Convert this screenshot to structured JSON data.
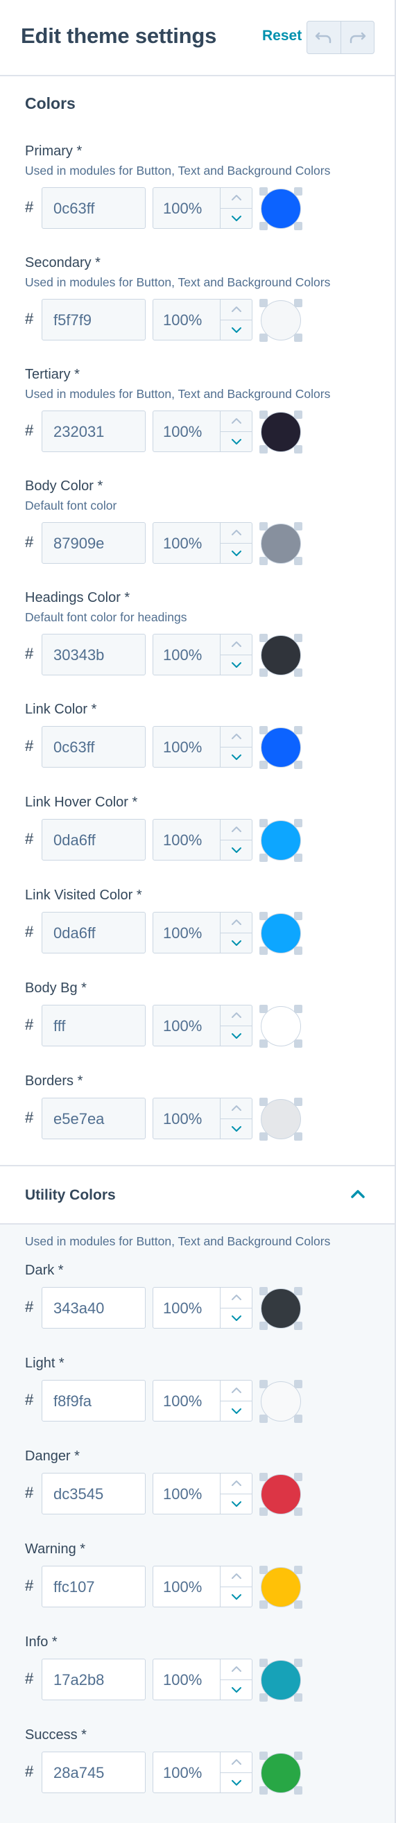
{
  "header": {
    "title": "Edit theme settings",
    "reset_label": "Reset"
  },
  "colors_section": {
    "title": "Colors",
    "fields": [
      {
        "label": "Primary *",
        "help": "Used in modules for Button, Text and Background Colors",
        "hex": "0c63ff",
        "opacity": "100%",
        "swatch": "#0c63ff"
      },
      {
        "label": "Secondary *",
        "help": "Used in modules for Button, Text and Background Colors",
        "hex": "f5f7f9",
        "opacity": "100%",
        "swatch": "#f5f7f9"
      },
      {
        "label": "Tertiary *",
        "help": "Used in modules for Button, Text and Background Colors",
        "hex": "232031",
        "opacity": "100%",
        "swatch": "#232031"
      },
      {
        "label": "Body Color *",
        "help": "Default font color",
        "hex": "87909e",
        "opacity": "100%",
        "swatch": "#87909e"
      },
      {
        "label": "Headings Color *",
        "help": "Default font color for headings",
        "hex": "30343b",
        "opacity": "100%",
        "swatch": "#30343b"
      },
      {
        "label": "Link Color *",
        "help": "",
        "hex": "0c63ff",
        "opacity": "100%",
        "swatch": "#0c63ff"
      },
      {
        "label": "Link Hover Color *",
        "help": "",
        "hex": "0da6ff",
        "opacity": "100%",
        "swatch": "#0da6ff"
      },
      {
        "label": "Link Visited Color *",
        "help": "",
        "hex": "0da6ff",
        "opacity": "100%",
        "swatch": "#0da6ff"
      },
      {
        "label": "Body Bg *",
        "help": "",
        "hex": "fff",
        "opacity": "100%",
        "swatch": "#ffffff"
      },
      {
        "label": "Borders *",
        "help": "",
        "hex": "e5e7ea",
        "opacity": "100%",
        "swatch": "#e5e7ea"
      }
    ]
  },
  "utility_section": {
    "title": "Utility Colors",
    "help": "Used in modules for Button, Text and Background Colors",
    "fields": [
      {
        "label": "Dark *",
        "hex": "343a40",
        "opacity": "100%",
        "swatch": "#343a40"
      },
      {
        "label": "Light *",
        "hex": "f8f9fa",
        "opacity": "100%",
        "swatch": "#f8f9fa"
      },
      {
        "label": "Danger *",
        "hex": "dc3545",
        "opacity": "100%",
        "swatch": "#dc3545"
      },
      {
        "label": "Warning *",
        "hex": "ffc107",
        "opacity": "100%",
        "swatch": "#ffc107"
      },
      {
        "label": "Info *",
        "hex": "17a2b8",
        "opacity": "100%",
        "swatch": "#17a2b8"
      },
      {
        "label": "Success *",
        "hex": "28a745",
        "opacity": "100%",
        "swatch": "#28a745"
      }
    ]
  },
  "hash_symbol": "#",
  "accent_color": "#0091ae",
  "icons": {
    "undo": "undo-icon",
    "redo": "redo-icon",
    "collapse": "chevron-up-icon",
    "step_up": "chevron-up-icon",
    "step_down": "chevron-down-icon"
  }
}
